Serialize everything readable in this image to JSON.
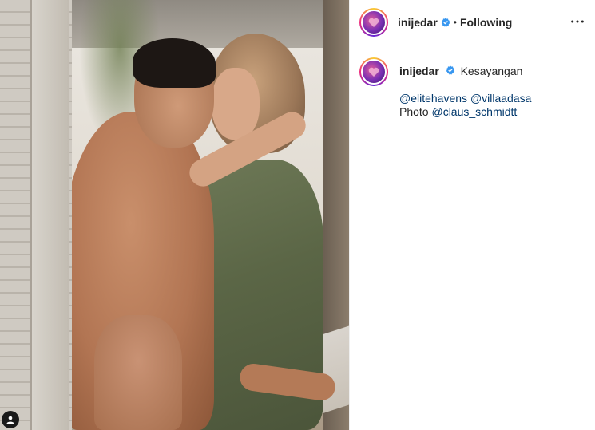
{
  "post": {
    "author": "inijedar",
    "verified": true,
    "follow_separator": "•",
    "follow_state": "Following",
    "more_icon": "more-horizontal-icon"
  },
  "caption": {
    "author": "inijedar",
    "text": "Kesayangan",
    "line1": {
      "mention1": "@elitehavens",
      "mention2": "@villaadasa"
    },
    "line2": {
      "prefix": "Photo",
      "mention": "@claus_schmidtt"
    }
  },
  "colors": {
    "verified_badge": "#3897f0",
    "link": "#00376b",
    "text": "#262626",
    "divider": "#efefef"
  }
}
